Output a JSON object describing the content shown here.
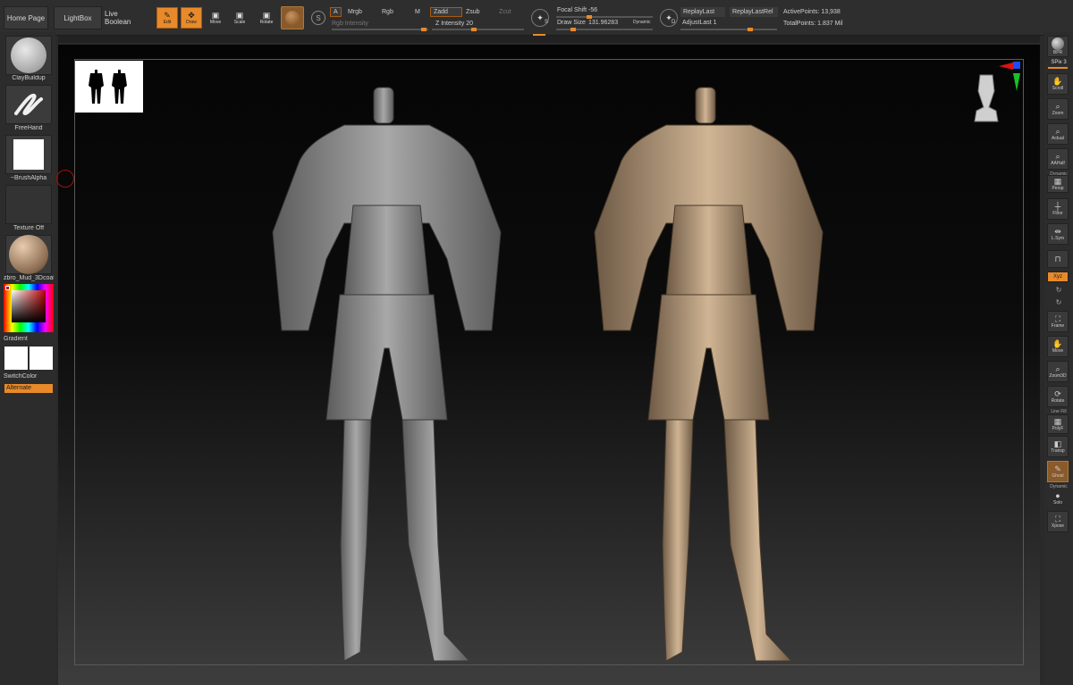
{
  "topbar": {
    "home_page": "Home Page",
    "lightbox": "LightBox",
    "live_boolean": "Live Boolean",
    "edit": "Edit",
    "draw": "Draw",
    "move": "Move",
    "scale": "Scale",
    "rotate": "Rotate",
    "a_label": "A",
    "mrgb": "Mrgb",
    "rgb": "Rgb",
    "m": "M",
    "rgb_intensity": "Rgb Intensity",
    "zadd": "Zadd",
    "zsub": "Zsub",
    "zcut": "Zcut",
    "z_intensity": "Z Intensity 20",
    "focal_shift": "Focal Shift -56",
    "draw_size_label": "Draw Size",
    "draw_size_value": "131.96283",
    "dynamic": "Dynamic",
    "replay_last": "ReplayLast",
    "replay_last_rel": "ReplayLastRel",
    "adjust_last": "AdjustLast 1",
    "active_points": "ActivePoints: 13,938",
    "total_points": "TotalPoints: 1.837 Mil",
    "s_label": "S",
    "d_label": "D"
  },
  "leftpanel": {
    "brush": "ClayBuildup",
    "stroke": "FreeHand",
    "alpha": "~BrushAlpha",
    "texture": "Texture Off",
    "material": "zbro_Mud_3Dcoat",
    "gradient": "Gradient",
    "switch_color": "SwitchColor",
    "alternate": "Alternate"
  },
  "rightpanel": {
    "bpr": "BPR",
    "spix": "SPix 3",
    "scroll": "Scroll",
    "zoom": "Zoom",
    "actual": "Actual",
    "aahalf": "AAHalf",
    "dynamic": "Dynamic",
    "persp": "Persp",
    "floor": "Floor",
    "lsym": "L.Sym",
    "xyz": "Xyz",
    "frame": "Frame",
    "move": "Move",
    "zoom3d": "Zoom3D",
    "rotate": "Rotate",
    "line_fill": "Line Fill",
    "polyf": "PolyF",
    "transp": "Transp",
    "ghost": "Ghost",
    "dynamic2": "Dynamic",
    "solo": "Solo",
    "xpose": "Xpose"
  },
  "colors": {
    "accent": "#e88a2a",
    "gray_model": "#8e8e8e",
    "clay_model": "#c8ac8c"
  },
  "icons": {
    "edit": "edit-icon",
    "draw": "draw-icon",
    "move": "move-icon",
    "scale": "scale-icon",
    "rotate": "rotate-icon",
    "gizmo": "gizmo-icon"
  }
}
